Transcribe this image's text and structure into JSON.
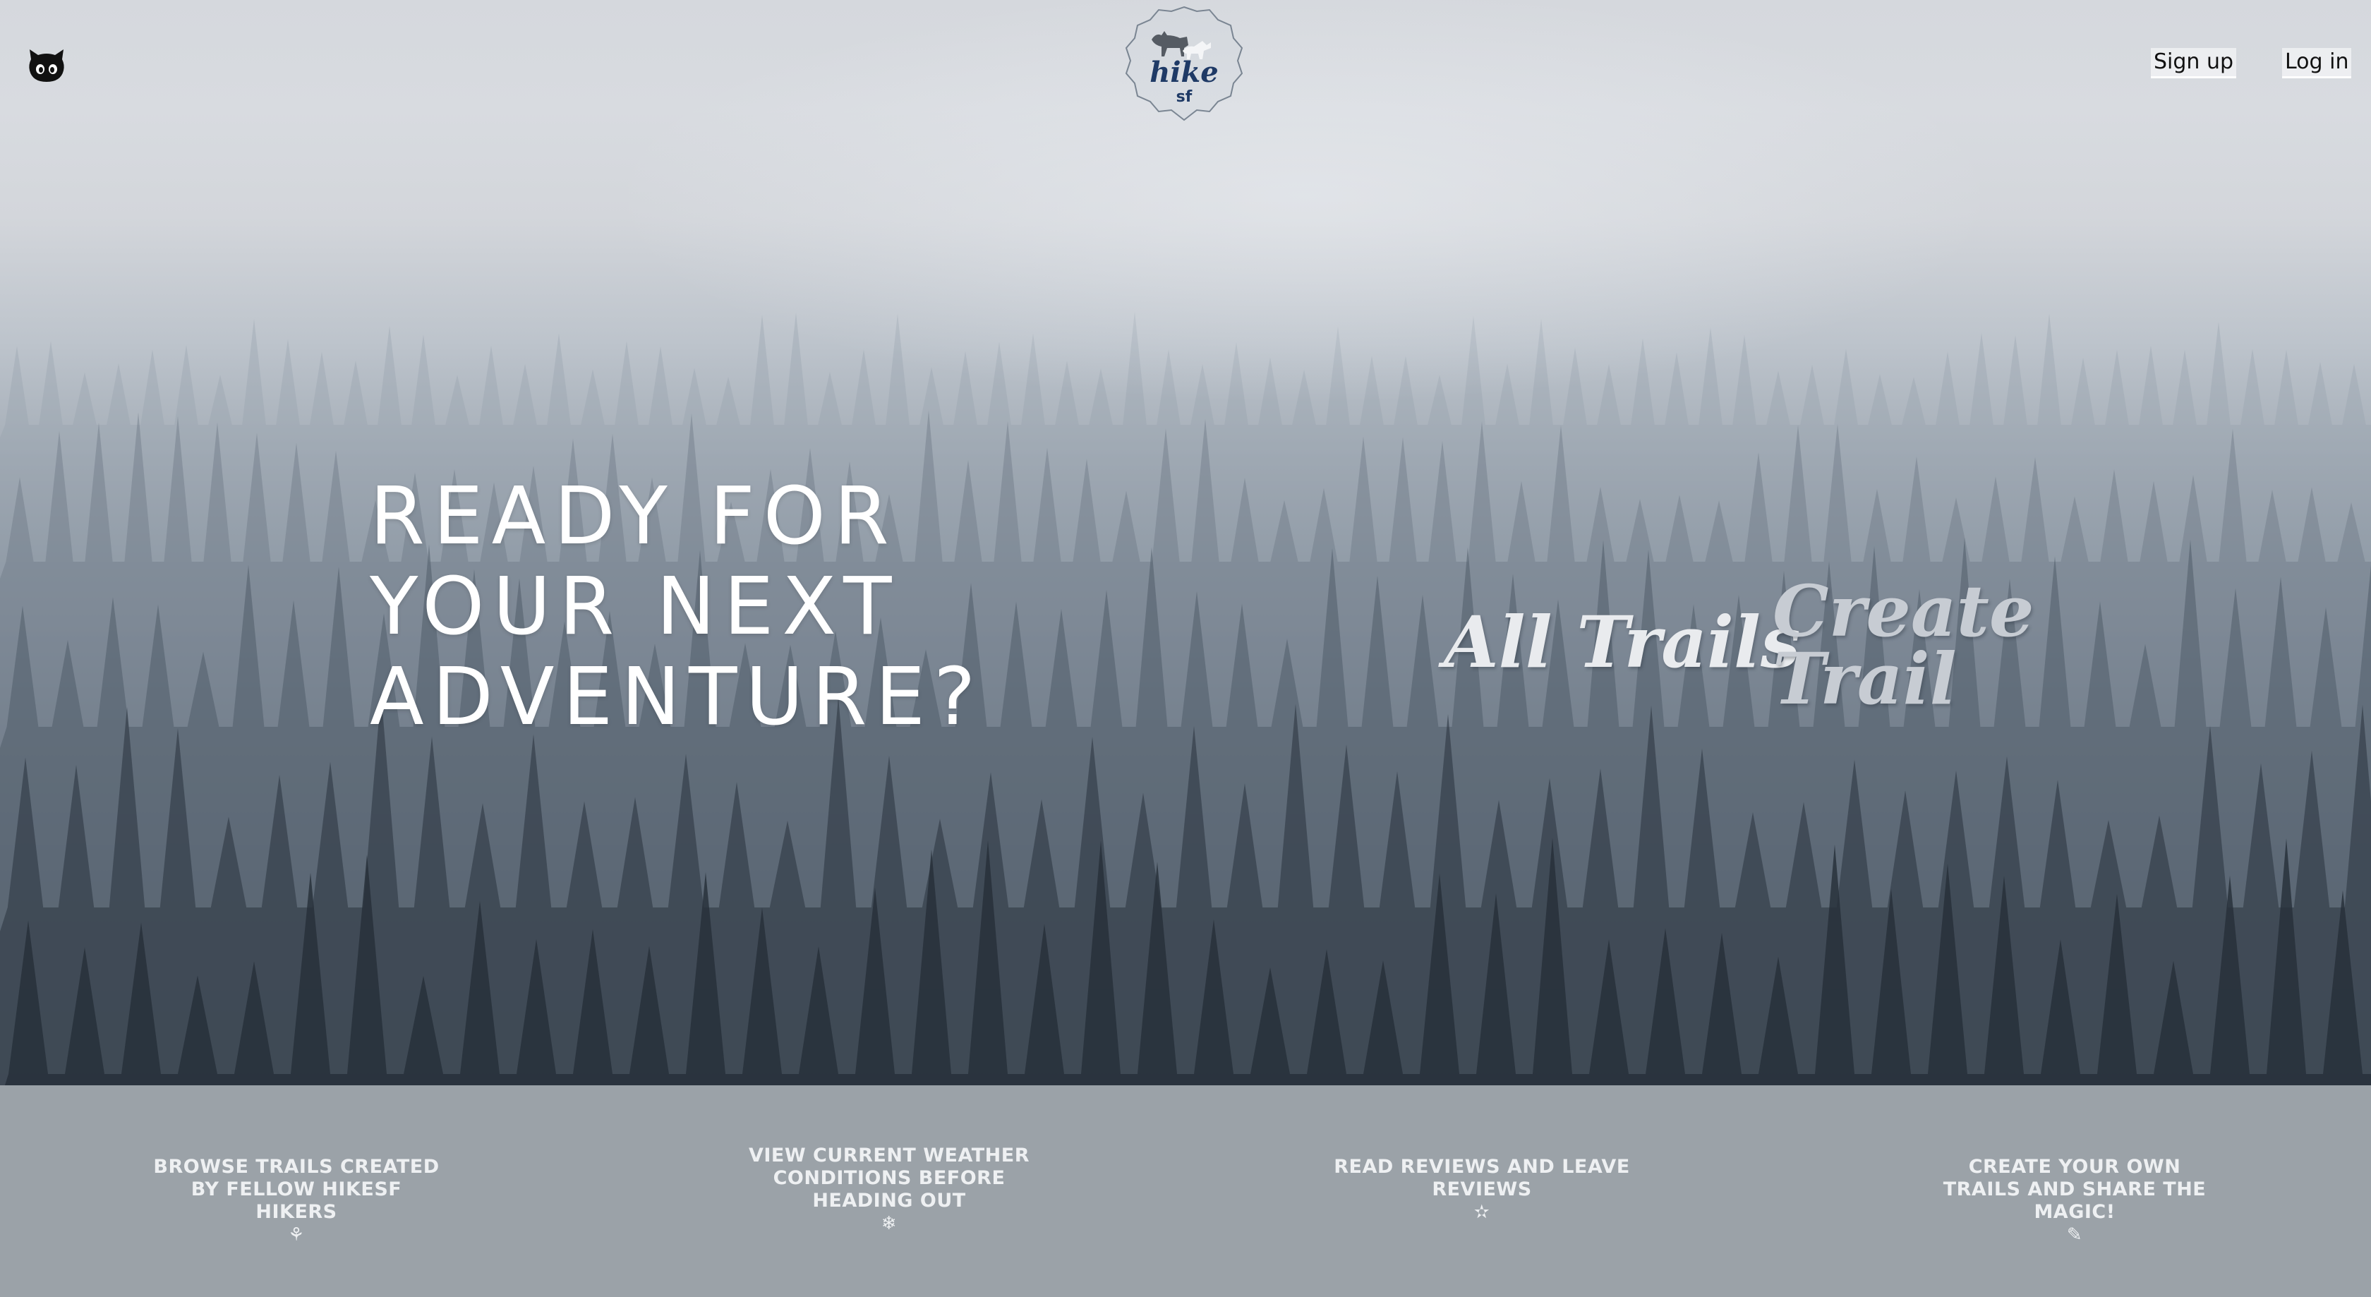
{
  "header": {
    "github_icon": "github-octocat-icon",
    "logo": {
      "word": "hike",
      "sub": "sf",
      "icon": "dogs-silhouette-icon"
    },
    "nav": {
      "signup_label": "Sign up",
      "login_label": "Log in"
    }
  },
  "hero": {
    "headline_lines": [
      "READY FOR",
      "YOUR NEXT",
      "ADVENTURE?"
    ],
    "actions": {
      "all_trails": "All Trails",
      "create_trail": "Create Trail"
    }
  },
  "features": [
    {
      "text": "BROWSE TRAILS CREATED BY FELLOW HIKESF HIKERS",
      "icon": "sprout-icon",
      "glyph": "⚘"
    },
    {
      "text": "VIEW CURRENT WEATHER CONDITIONS BEFORE HEADING OUT",
      "icon": "snowflake-icon",
      "glyph": "❄"
    },
    {
      "text": "READ REVIEWS AND LEAVE REVIEWS",
      "icon": "star-icon",
      "glyph": "✫"
    },
    {
      "text": "CREATE YOUR OWN TRAILS AND SHARE THE MAGIC!",
      "icon": "pencil-icon",
      "glyph": "✎"
    }
  ],
  "colors": {
    "footer_bg": "#9ba2a8",
    "logo_text": "#1f3a66",
    "headline": "#ffffff"
  }
}
